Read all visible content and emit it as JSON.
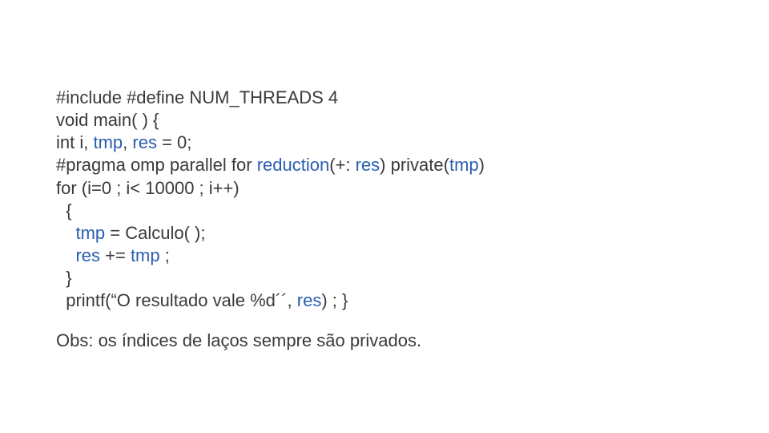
{
  "code": {
    "l1a": "#include #define NUM_THREADS 4",
    "l2a": "void main( ) {",
    "l3a": "int i, ",
    "l3b": "tmp",
    "l3c": ", ",
    "l3d": "res",
    "l3e": " = 0;",
    "l4a": "#pragma omp parallel for ",
    "l4b": "reduction",
    "l4c": "(+: ",
    "l4d": "res",
    "l4e": ") private(",
    "l4f": "tmp",
    "l4g": ")",
    "l5a": "for (i=0 ; i< 10000 ; i++)",
    "l6a": "  {",
    "l7a": "    ",
    "l7b": "tmp",
    "l7c": " = Calculo( );",
    "l8a": "    ",
    "l8b": "res",
    "l8c": " += ",
    "l8d": "tmp",
    "l8e": " ;",
    "l9a": "  }",
    "l10a": "  printf(“O resultado vale %d´´, ",
    "l10b": "res",
    "l10c": ") ; }"
  },
  "note": "Obs: os índices de laços sempre são privados."
}
